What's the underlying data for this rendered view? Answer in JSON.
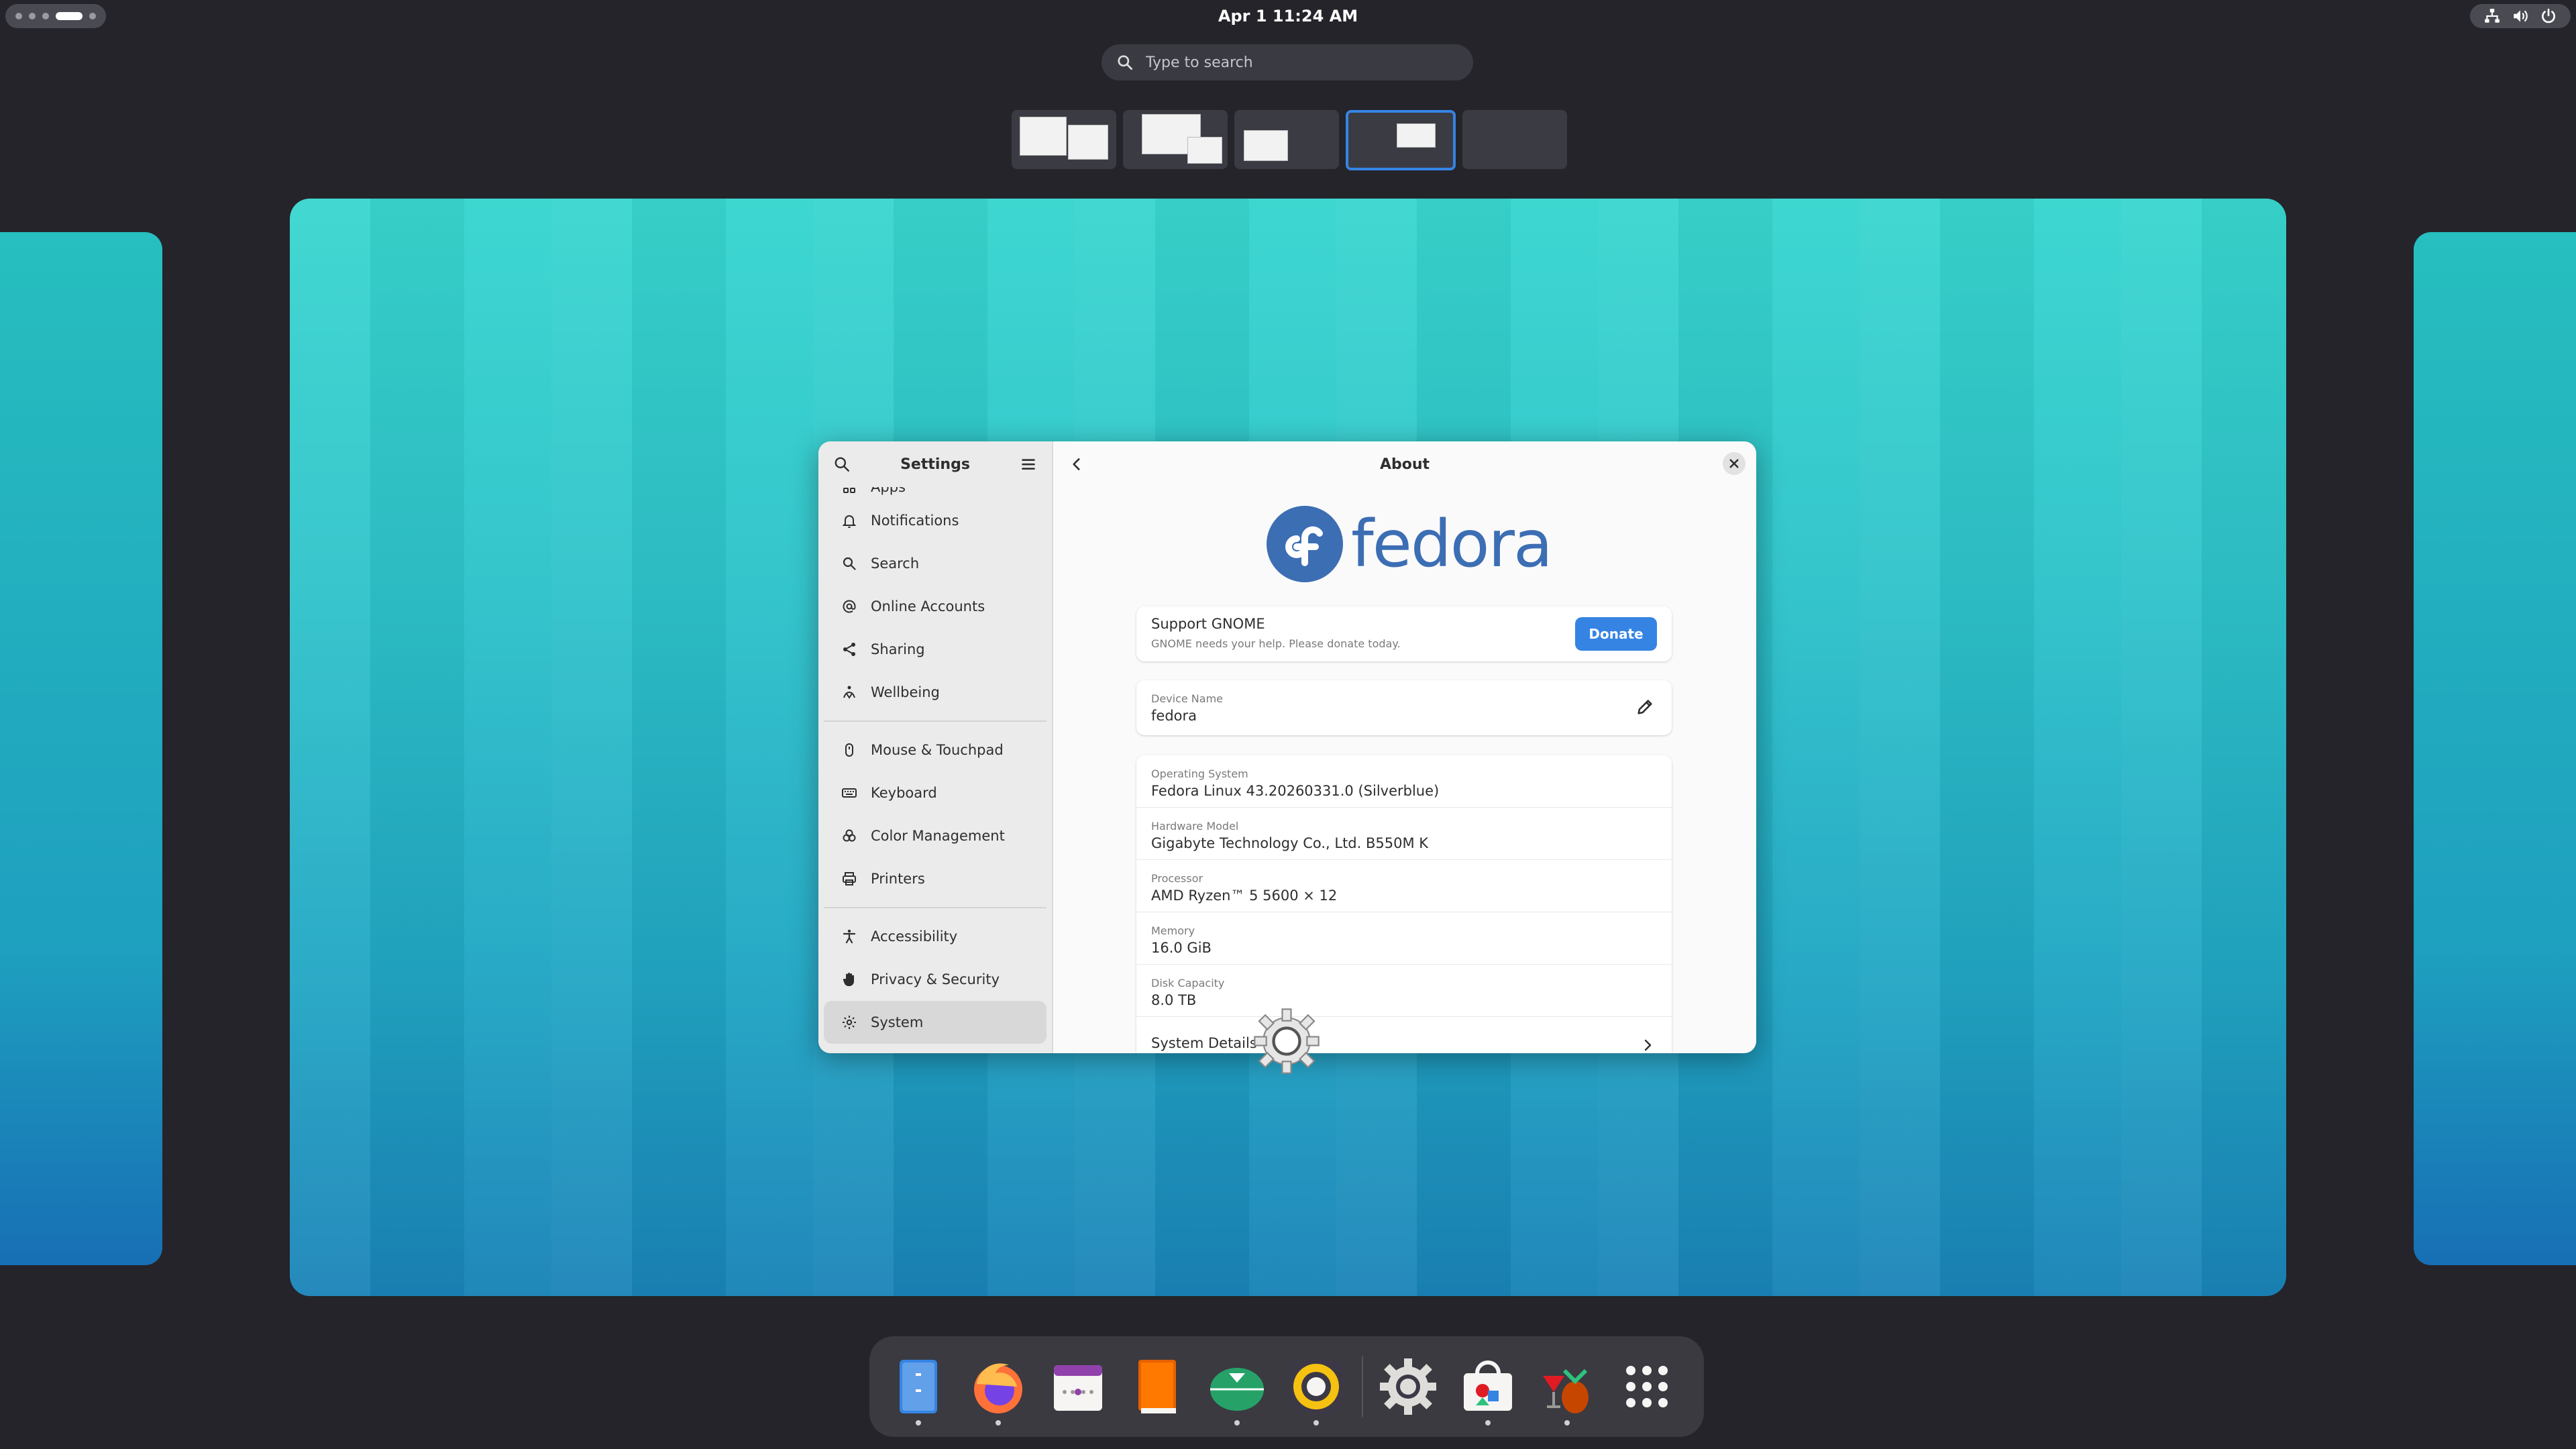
{
  "topbar": {
    "clock": "Apr 1  11:24 AM",
    "tray_icons": [
      "network-icon",
      "volume-icon",
      "power-icon"
    ]
  },
  "overview": {
    "search_placeholder": "Type to search",
    "workspace_count": 5,
    "active_workspace": 4
  },
  "settings": {
    "sidebar_title": "Settings",
    "sidebar_items": [
      {
        "label": "Apps",
        "icon": "apps-icon"
      },
      {
        "label": "Notifications",
        "icon": "bell-icon"
      },
      {
        "label": "Search",
        "icon": "search-icon"
      },
      {
        "label": "Online Accounts",
        "icon": "at-icon"
      },
      {
        "label": "Sharing",
        "icon": "share-icon"
      },
      {
        "label": "Wellbeing",
        "icon": "wellbeing-icon"
      },
      {
        "label": "Mouse & Touchpad",
        "icon": "mouse-icon"
      },
      {
        "label": "Keyboard",
        "icon": "keyboard-icon"
      },
      {
        "label": "Color Management",
        "icon": "color-icon"
      },
      {
        "label": "Printers",
        "icon": "printer-icon"
      },
      {
        "label": "Accessibility",
        "icon": "accessibility-icon"
      },
      {
        "label": "Privacy & Security",
        "icon": "hand-icon"
      },
      {
        "label": "System",
        "icon": "gear-icon"
      }
    ],
    "selected_item": "System",
    "page_title": "About",
    "logo_text": "fedora",
    "support": {
      "title": "Support GNOME",
      "subtitle": "GNOME needs your help. Please donate today.",
      "button": "Donate"
    },
    "device": {
      "label": "Device Name",
      "value": "fedora"
    },
    "info": [
      {
        "label": "Operating System",
        "value": "Fedora Linux 43.20260331.0 (Silverblue)"
      },
      {
        "label": "Hardware Model",
        "value": "Gigabyte Technology Co., Ltd. B550M K"
      },
      {
        "label": "Processor",
        "value": "AMD Ryzen™ 5 5600 × 12"
      },
      {
        "label": "Memory",
        "value": "16.0 GiB"
      },
      {
        "label": "Disk Capacity",
        "value": "8.0 TB"
      }
    ],
    "system_details": "System Details"
  },
  "colors": {
    "accent": "#3584e4",
    "fedora_blue": "#3c6eb4",
    "panel_bg": "#24242a"
  },
  "dock": {
    "apps": [
      {
        "name": "files-icon",
        "running": true
      },
      {
        "name": "firefox-icon",
        "running": true
      },
      {
        "name": "calendar-icon",
        "running": false
      },
      {
        "name": "books-icon",
        "running": false
      },
      {
        "name": "download-manager-icon",
        "running": true
      },
      {
        "name": "rhythmbox-icon",
        "running": true
      },
      {
        "name": "settings-icon",
        "running": false
      },
      {
        "name": "software-icon",
        "running": true
      },
      {
        "name": "wine-icon",
        "running": true
      },
      {
        "name": "app-grid-icon",
        "running": false
      }
    ]
  }
}
